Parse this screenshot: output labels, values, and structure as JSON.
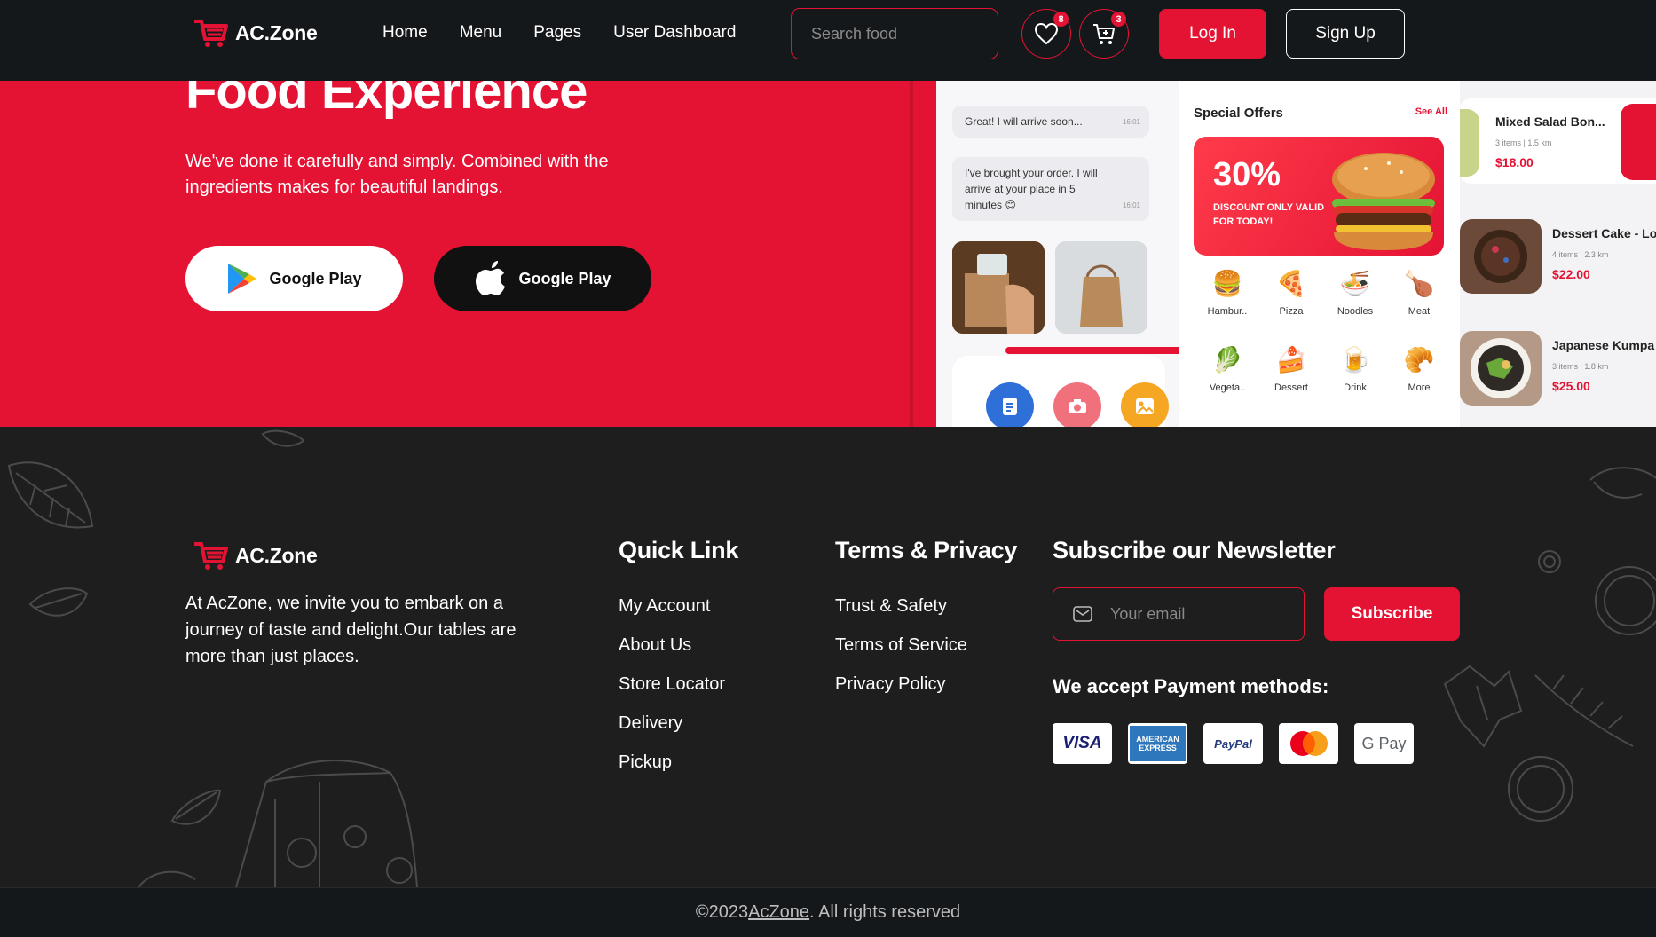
{
  "header": {
    "brand": "AC.Zone",
    "nav": [
      "Home",
      "Menu",
      "Pages",
      "User Dashboard"
    ],
    "search_placeholder": "Search food",
    "wishlist_count": "8",
    "cart_count": "3",
    "login_label": "Log In",
    "signup_label": "Sign Up"
  },
  "hero": {
    "title": "Food Experience",
    "subtitle": "We've done it carefully and simply. Combined with the ingredients makes for beautiful landings.",
    "google_play_label": "Google Play",
    "apple_label": "Google Play"
  },
  "mockup": {
    "chat_1": "Great! I will arrive soon...",
    "chat_1_time": "16:01",
    "chat_2": "I've brought your order. I will arrive at your place in 5 minutes 😊",
    "chat_2_time": "16:01",
    "offers_title": "Special Offers",
    "see_all": "See All",
    "offer_percent": "30%",
    "offer_note": "DISCOUNT ONLY VALID FOR TODAY!",
    "categories": [
      {
        "label": "Hambur..",
        "icon": "🍔"
      },
      {
        "label": "Pizza",
        "icon": "🍕"
      },
      {
        "label": "Noodles",
        "icon": "🍜"
      },
      {
        "label": "Meat",
        "icon": "🍗"
      },
      {
        "label": "Vegeta..",
        "icon": "🥬"
      },
      {
        "label": "Dessert",
        "icon": "🍰"
      },
      {
        "label": "Drink",
        "icon": "🍺"
      },
      {
        "label": "More",
        "icon": "🥐"
      }
    ],
    "dishes": [
      {
        "name": "Mixed Salad Bon...",
        "meta": "3 items  |  1.5 km",
        "price": "$18.00"
      },
      {
        "name": "Dessert Cake - Lo",
        "meta": "4 items  |  2.3 km",
        "price": "$22.00"
      },
      {
        "name": "Japanese Kumpa",
        "meta": "3 items  |  1.8 km",
        "price": "$25.00"
      }
    ]
  },
  "footer": {
    "brand": "AC.Zone",
    "description": "At AcZone, we invite you to embark on a journey of taste and delight.Our tables are more than just places.",
    "quick_link_title": "Quick Link",
    "quick_links": [
      "My Account",
      "About Us",
      "Store Locator",
      "Delivery",
      "Pickup"
    ],
    "terms_title": "Terms & Privacy",
    "terms_links": [
      "Trust & Safety",
      "Terms of Service",
      "Privacy Policy"
    ],
    "newsletter_title": "Subscribe our Newsletter",
    "email_placeholder": "Your email",
    "subscribe_label": "Subscribe",
    "payment_title": "We accept Payment methods:",
    "payments": [
      "VISA",
      "AMERICAN EXPRESS",
      "PayPal",
      "Mastercard",
      "G Pay"
    ]
  },
  "copyright": {
    "prefix": "©2023 ",
    "link": "AcZone",
    "suffix": ". All rights reserved"
  },
  "colors": {
    "accent": "#e41334",
    "header_bg": "#15181b",
    "footer_bg": "#1e1e1e"
  }
}
